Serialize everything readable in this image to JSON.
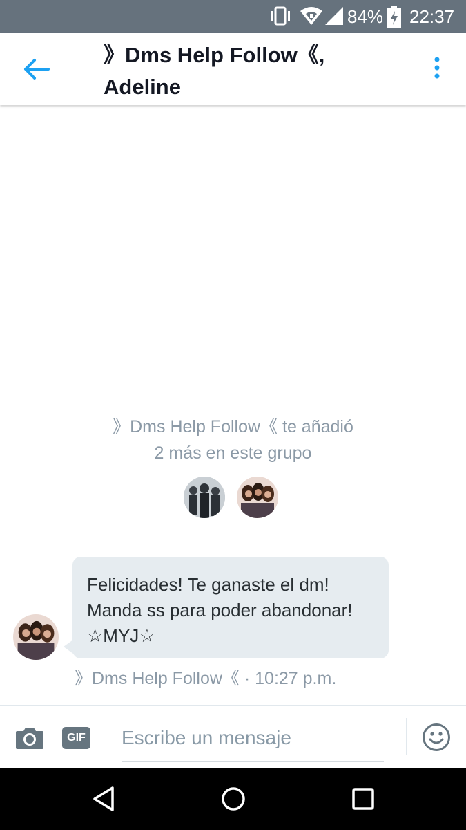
{
  "status_bar": {
    "battery": "84%",
    "time": "22:37",
    "icons": [
      "vibrate-icon",
      "wifi-icon",
      "signal-icon",
      "battery-charging-icon"
    ]
  },
  "header": {
    "title_line1": "》Dms Help Follow《,",
    "title_line2": "Adeline",
    "back_icon": "arrow-left-icon",
    "menu_icon": "more-vertical-icon",
    "accent_color": "#1da1f2"
  },
  "conversation": {
    "system_message_line1": "》Dms Help Follow《 te añadió",
    "system_message_line2": "2 más en este grupo",
    "message": {
      "lines": [
        "Felicidades! Te ganaste el dm!",
        "Manda ss para poder abandonar!",
        "☆MYJ☆"
      ],
      "meta": "》Dms Help Follow《 · 10:27 p.m.",
      "bubble_color": "#e6ecf0"
    }
  },
  "composer": {
    "gif_label": "GIF",
    "placeholder": "Escribe un mensaje",
    "icons": [
      "camera-icon",
      "gif-icon",
      "emoji-icon"
    ]
  },
  "nav_bar": {
    "icons": [
      "back-triangle-icon",
      "home-circle-icon",
      "recents-square-icon"
    ]
  }
}
